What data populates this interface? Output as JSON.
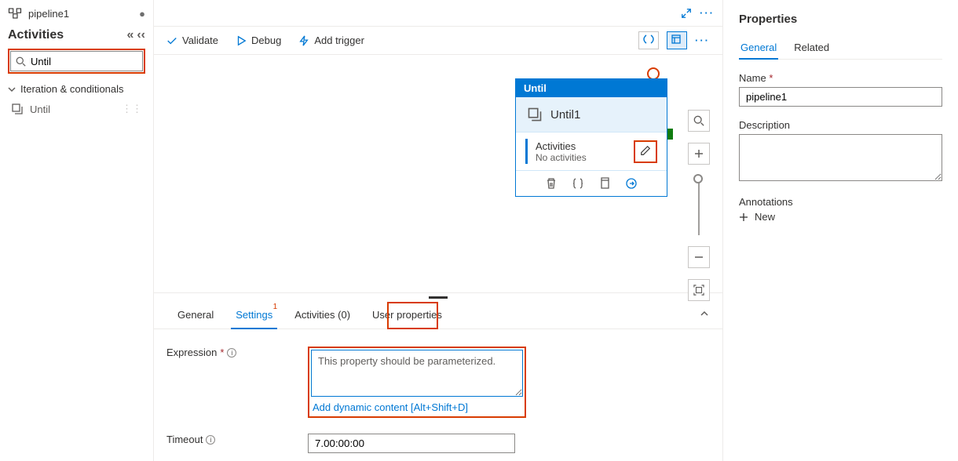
{
  "tab": {
    "name": "pipeline1"
  },
  "sidebar": {
    "heading": "Activities",
    "search_value": "Until",
    "category": "Iteration & conditionals",
    "item": "Until"
  },
  "toolbar": {
    "validate": "Validate",
    "debug": "Debug",
    "add_trigger": "Add trigger"
  },
  "node": {
    "type": "Until",
    "name": "Until1",
    "activities_label": "Activities",
    "no_activities": "No activities"
  },
  "bottom_tabs": {
    "general": "General",
    "settings": "Settings",
    "settings_badge": "1",
    "activities": "Activities (0)",
    "user_props": "User properties"
  },
  "settings": {
    "expression_label": "Expression",
    "expression_placeholder": "This property should be parameterized.",
    "dynamic_link": "Add dynamic content [Alt+Shift+D]",
    "timeout_label": "Timeout",
    "timeout_value": "7.00:00:00"
  },
  "properties": {
    "title": "Properties",
    "tab_general": "General",
    "tab_related": "Related",
    "name_label": "Name",
    "name_value": "pipeline1",
    "desc_label": "Description",
    "annotations_label": "Annotations",
    "new": "New"
  }
}
